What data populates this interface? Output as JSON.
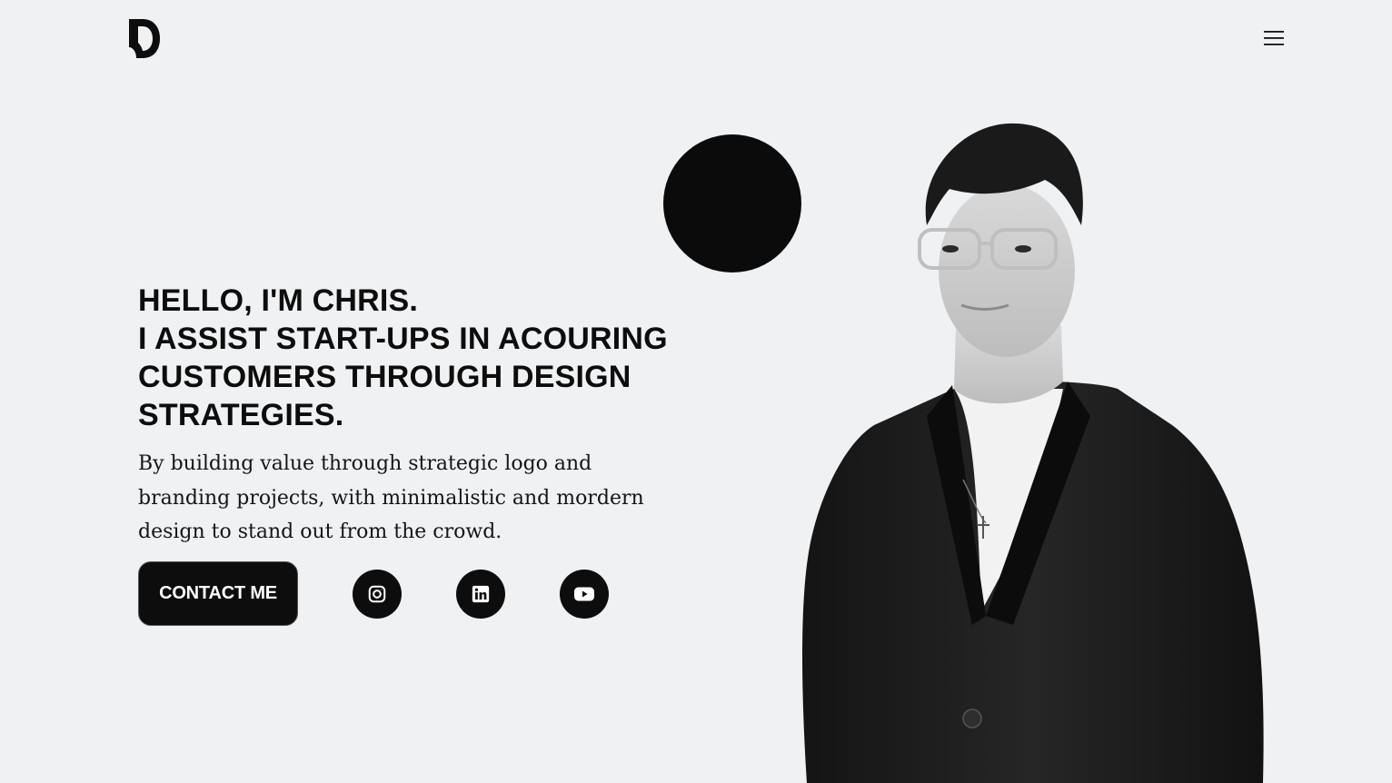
{
  "header": {
    "logo_icon": "d-monogram-logo",
    "menu_icon": "hamburger-menu-icon"
  },
  "hero": {
    "headline_lines": [
      "HELLO, I'M CHRIS.",
      "I ASSIST START-UPS IN ACOURING",
      "CUSTOMERS THROUGH DESIGN",
      "STRATEGIES."
    ],
    "subtext_lines": [
      "By building value through strategic logo and",
      "branding projects, with minimalistic and mordern",
      "design to stand out from the crowd."
    ],
    "contact_label": "CONTACT ME",
    "socials": [
      {
        "icon": "instagram-icon"
      },
      {
        "icon": "linkedin-icon"
      },
      {
        "icon": "youtube-icon"
      }
    ]
  },
  "colors": {
    "background": "#f0f1f3",
    "primary": "#0d0d0d",
    "on_primary": "#ffffff"
  }
}
